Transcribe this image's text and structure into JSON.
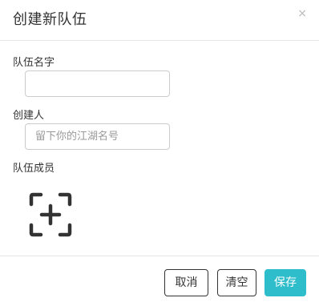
{
  "modal": {
    "title": "创建新队伍",
    "close_symbol": "×"
  },
  "form": {
    "team_name": {
      "label": "队伍名字",
      "value": "",
      "placeholder": ""
    },
    "creator": {
      "label": "创建人",
      "value": "",
      "placeholder": "留下你的江湖名号"
    },
    "members": {
      "label": "队伍成员",
      "add_icon": "scan-plus-icon"
    }
  },
  "footer": {
    "cancel_label": "取消",
    "clear_label": "清空",
    "save_label": "保存"
  },
  "colors": {
    "primary": "#2ebdcb",
    "border": "#cccccc",
    "icon": "#333333"
  }
}
